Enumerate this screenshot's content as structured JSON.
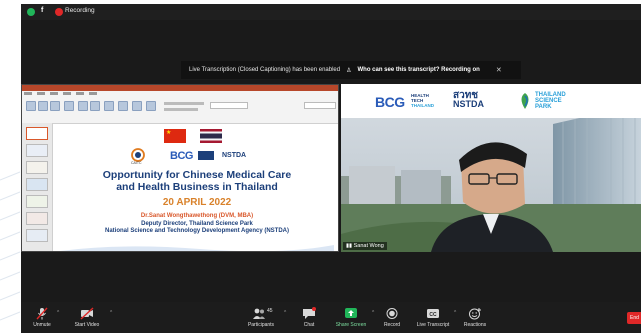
{
  "recording": {
    "label": "Recording"
  },
  "caption_banner": {
    "message": "Live Transcription (Closed Captioning) has been enabled",
    "question": "Who can see this transcript? Recording on",
    "close_icon": "close-icon"
  },
  "slide": {
    "title_line1": "Opportunity for Chinese Medical Care",
    "title_line2": "and Health Business in Thailand",
    "date": "20 APRIL 2022",
    "speaker_name": "Dr.Sanat Wongthawethong (DVM, MBA)",
    "speaker_role": "Deputy Director, Thailand Science Park",
    "organization": "National Science and Technology Development Agency (NSTDA)",
    "logo_bcg": "BCG",
    "logo_nstda": "NSTDA",
    "logo_caitc": "CAITC"
  },
  "video": {
    "participant_name": "Sanat Wong",
    "logo_bcg": "BCG",
    "logo_bcg_sub_1": "HEALTH",
    "logo_bcg_sub_2": "TECH",
    "logo_bcg_sub_3": "THAILAND",
    "logo_nstda_th": "สวทช",
    "logo_nstda": "NSTDA",
    "logo_tsp_1": "THAILAND",
    "logo_tsp_2": "SCIENCE",
    "logo_tsp_3": "PARK"
  },
  "toolbar": {
    "unmute": "Unmute",
    "start_video": "Start Video",
    "participants": "Participants",
    "participants_count": "45",
    "chat": "Chat",
    "share_screen": "Share Screen",
    "record": "Record",
    "live_transcript": "Live Transcript",
    "reactions": "Reactions",
    "end": "End"
  },
  "colors": {
    "zoom_dark": "#1a1a1a",
    "share_green": "#21b65a",
    "end_red": "#e02828",
    "slide_blue": "#1c3f7a",
    "slide_orange": "#d9822b"
  }
}
